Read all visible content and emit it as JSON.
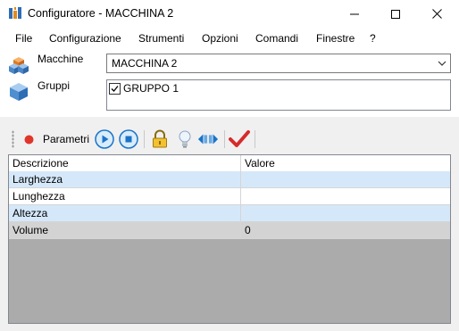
{
  "window": {
    "title": "Configuratore - MACCHINA 2",
    "icon": "app-icon",
    "controls": {
      "minimize": "minimize-icon",
      "maximize": "maximize-icon",
      "close": "close-icon"
    }
  },
  "menu": {
    "items": [
      {
        "label": "File"
      },
      {
        "label": "Configurazione"
      },
      {
        "label": "Strumenti"
      },
      {
        "label": "Opzioni"
      },
      {
        "label": "Comandi"
      },
      {
        "label": "Finestre"
      },
      {
        "label": "?"
      }
    ]
  },
  "machines": {
    "label": "Macchine",
    "icon": "machines-cubes-icon",
    "selected": "MACCHINA 2"
  },
  "groups": {
    "label": "Gruppi",
    "icon": "groups-cube-icon",
    "items": [
      {
        "label": "GRUPPO 1",
        "checked": true
      }
    ]
  },
  "toolbar": {
    "label": "Parametri",
    "record_icon": "record-icon",
    "buttons": [
      "play-icon",
      "stop-icon",
      "lock-icon",
      "lightbulb-icon",
      "split-arrows-icon",
      "checkmark-icon"
    ]
  },
  "grid": {
    "columns": [
      "Descrizione",
      "Valore"
    ],
    "rows": [
      {
        "descrizione": "Larghezza",
        "valore": ""
      },
      {
        "descrizione": "Lunghezza",
        "valore": ""
      },
      {
        "descrizione": "Altezza",
        "valore": ""
      },
      {
        "descrizione": "Volume",
        "valore": "0"
      }
    ]
  },
  "colors": {
    "row_alt": "#d5e8fa",
    "row_readonly": "#d3d3d3",
    "panel": "#f0f0f0",
    "accent_blue": "#1a73c9"
  }
}
